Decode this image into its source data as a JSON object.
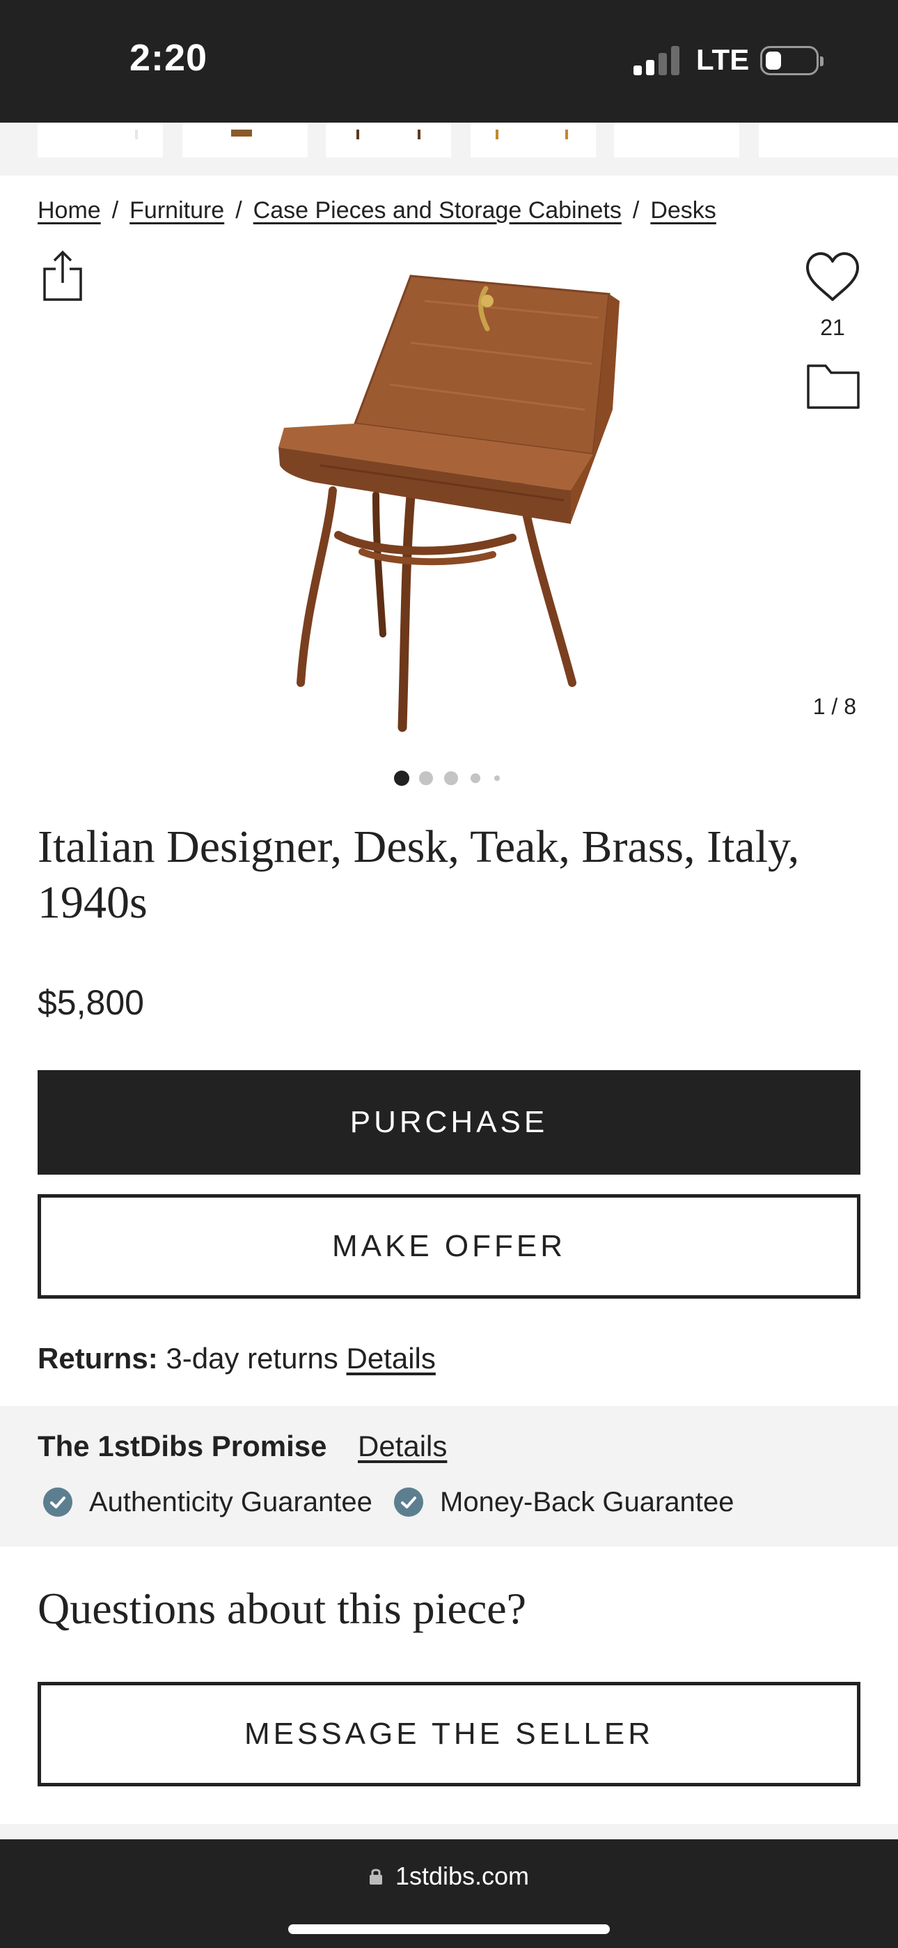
{
  "status_bar": {
    "time": "2:20",
    "network": "LTE",
    "signal_bars_active": 2,
    "signal_bars_total": 4,
    "battery_level": 0.2
  },
  "breadcrumb": [
    {
      "label": "Home"
    },
    {
      "label": "Furniture"
    },
    {
      "label": "Case Pieces and Storage Cabinets"
    },
    {
      "label": "Desks"
    }
  ],
  "breadcrumb_separator": "/",
  "gallery": {
    "favorites_count": "21",
    "image_counter": "1 / 8",
    "active_dot": 0,
    "image_icon": "teak-desk-photo"
  },
  "product": {
    "title": "Italian Designer, Desk, Teak, Brass, Italy, 1940s",
    "price": "$5,800"
  },
  "actions": {
    "purchase_label": "PURCHASE",
    "offer_label": "MAKE OFFER"
  },
  "returns": {
    "label": "Returns:",
    "value": "3-day returns",
    "details_link": "Details"
  },
  "promise": {
    "title": "The 1stDibs Promise",
    "details_link": "Details",
    "guarantees": [
      "Authenticity Guarantee",
      "Money-Back Guarantee"
    ]
  },
  "questions": {
    "heading": "Questions about this piece?",
    "message_label": "MESSAGE THE SELLER"
  },
  "browser": {
    "url": "1stdibs.com"
  },
  "colors": {
    "dark": "#222222",
    "panel": "#f3f3f3",
    "check": "#5c7f8f",
    "wood": "#9c5a31"
  }
}
